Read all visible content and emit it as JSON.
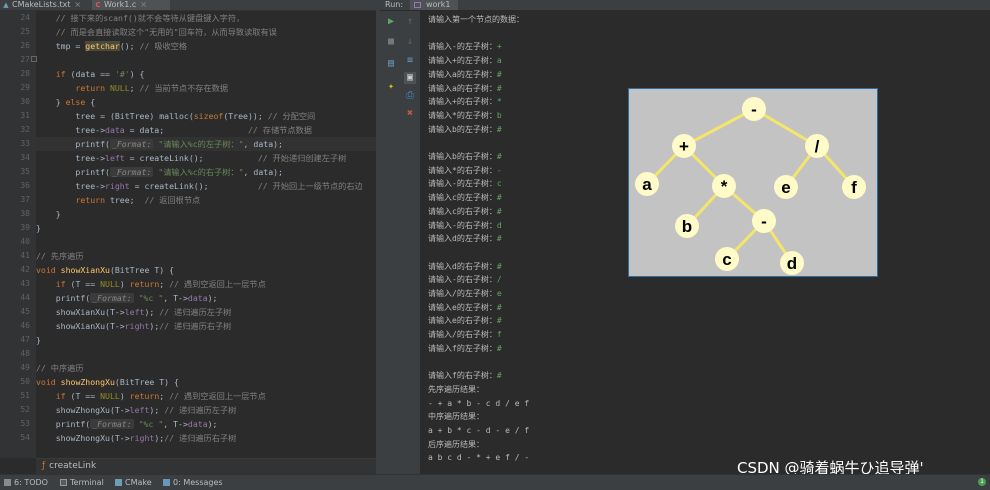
{
  "tabs": [
    {
      "label": "CMakeLists.txt",
      "icon": "cmake-file-icon"
    },
    {
      "label": "Work1.c",
      "icon": "c-file-icon"
    }
  ],
  "gutter": {
    "line_numbers": [
      "24",
      "25",
      "26",
      "27",
      "28",
      "29",
      "30",
      "31",
      "32",
      "33",
      "34",
      "35",
      "36",
      "37",
      "38",
      "39",
      "40",
      "41",
      "42",
      "43",
      "44",
      "45",
      "46",
      "47",
      "48",
      "49",
      "50",
      "51",
      "52",
      "53",
      "54"
    ]
  },
  "code": {
    "l1": "    // 接下来的scanf()就不会等待从键盘键入字符，",
    "l2": "    // 而是会直接读取这个\"无用的\"回车符，从而导致读取有误",
    "l3a": "    tmp = ",
    "l3b": "getchar",
    "l3c": "(); ",
    "l3d": "// 吸收空格",
    "l5a": "    if ",
    "l5b": "(data == ",
    "l5c": "'#'",
    "l5d": ") {",
    "l6a": "        return ",
    "l6b": "NULL",
    "l6c": "; ",
    "l6d": "// 当前节点不存在数据",
    "l7a": "    } ",
    "l7b": "else ",
    "l7c": "{",
    "l8a": "        tree = (BitTree) ",
    "l8b": "malloc",
    "l8c": "(",
    "l8d": "sizeof",
    "l8e": "(Tree)); ",
    "l8f": "// 分配空间",
    "l9a": "        tree->",
    "l9b": "data",
    "l9c": " = data;                 ",
    "l9d": "// 存储节点数据",
    "l10a": "        printf(",
    "l10h": "_Format:",
    "l10b": " \"请输入%c的左子树：\"",
    "l10c": ", data);",
    "l11a": "        tree->",
    "l11b": "left",
    "l11c": " = createLink();           ",
    "l11d": "// 开始递归创建左子树",
    "l12a": "        printf(",
    "l12h": "_Format:",
    "l12b": " \"请输入%c的右子树：\"",
    "l12c": ", data);",
    "l13a": "        tree->",
    "l13b": "right",
    "l13c": " = createLink();          ",
    "l13d": "// 开始回上一级节点的右边",
    "l14a": "        ",
    "l14b": "return ",
    "l14c": "tree;  ",
    "l14d": "// 返回根节点",
    "l15": "    }",
    "l16": "}",
    "l18": "// 先序遍历",
    "l19a": "void ",
    "l19b": "showXianXu",
    "l19c": "(BitTree T) {",
    "l20a": "    if ",
    "l20b": "(T == ",
    "l20c": "NULL",
    "l20d": ") ",
    "l20e": "return",
    "l20f": "; ",
    "l20g": "// 遇到空返回上一层节点",
    "l21a": "    printf(",
    "l21h": "_Format:",
    "l21b": " \"%c \"",
    "l21c": ", T->",
    "l21d": "data",
    "l21e": ");",
    "l22a": "    showXianXu(T->",
    "l22b": "left",
    "l22c": "); ",
    "l22d": "// 递归遍历左子树",
    "l23a": "    showXianXu(T->",
    "l23b": "right",
    "l23c": ");",
    "l23d": "// 递归遍历右子树",
    "l24": "}",
    "l26": "// 中序遍历",
    "l27a": "void ",
    "l27b": "showZhongXu",
    "l27c": "(BitTree T) {",
    "l28a": "    if ",
    "l28b": "(T == ",
    "l28c": "NULL",
    "l28d": ") ",
    "l28e": "return",
    "l28f": "; ",
    "l28g": "// 遇到空返回上一层节点",
    "l29a": "    showZhongXu(T->",
    "l29b": "left",
    "l29c": "); ",
    "l29d": "// 递归遍历左子树",
    "l30a": "    printf(",
    "l30h": "_Format:",
    "l30b": " \"%c \"",
    "l30c": ", T->",
    "l30d": "data",
    "l30e": ");",
    "l31a": "    showZhongXu(T->",
    "l31b": "right",
    "l31c": ");",
    "l31d": "// 递归遍历右子树"
  },
  "breadcrumb": {
    "icon": "function-icon",
    "label": "createLink"
  },
  "statusbar": {
    "todo": "6: TODO",
    "terminal": "Terminal",
    "cmake": "CMake",
    "messages": "0: Messages",
    "notifications": "1"
  },
  "run": {
    "label": "Run:",
    "tab": "work1"
  },
  "console": {
    "lines": [
      {
        "t": "请输入第一个节点的数据：",
        "i": ""
      },
      {
        "t": "",
        "i": ""
      },
      {
        "t": "请输入-的左子树：",
        "i": "+"
      },
      {
        "t": "请输入+的左子树：",
        "i": "a"
      },
      {
        "t": "请输入a的左子树：",
        "i": "#"
      },
      {
        "t": "请输入a的右子树：",
        "i": "#"
      },
      {
        "t": "请输入+的右子树：",
        "i": "*"
      },
      {
        "t": "请输入*的左子树：",
        "i": "b"
      },
      {
        "t": "请输入b的左子树：",
        "i": "#"
      },
      {
        "t": "",
        "i": ""
      },
      {
        "t": "请输入b的右子树：",
        "i": "#"
      },
      {
        "t": "请输入*的右子树：",
        "i": "-"
      },
      {
        "t": "请输入-的左子树：",
        "i": "c"
      },
      {
        "t": "请输入c的左子树：",
        "i": "#"
      },
      {
        "t": "请输入c的右子树：",
        "i": "#"
      },
      {
        "t": "请输入-的右子树：",
        "i": "d"
      },
      {
        "t": "请输入d的左子树：",
        "i": "#"
      },
      {
        "t": "",
        "i": ""
      },
      {
        "t": "请输入d的右子树：",
        "i": "#"
      },
      {
        "t": "请输入-的右子树：",
        "i": "/"
      },
      {
        "t": "请输入/的左子树：",
        "i": "e"
      },
      {
        "t": "请输入e的左子树：",
        "i": "#"
      },
      {
        "t": "请输入e的右子树：",
        "i": "#"
      },
      {
        "t": "请输入/的右子树：",
        "i": "f"
      },
      {
        "t": "请输入f的左子树：",
        "i": "#"
      },
      {
        "t": "",
        "i": ""
      },
      {
        "t": "请输入f的右子树：",
        "i": "#"
      },
      {
        "t": "先序遍历结果：",
        "i": ""
      },
      {
        "t": "- + a * b - c d / e f",
        "i": ""
      },
      {
        "t": "中序遍历结果：",
        "i": ""
      },
      {
        "t": "a + b * c - d - e / f",
        "i": ""
      },
      {
        "t": "后序遍历结果：",
        "i": ""
      },
      {
        "t": "a b c d - * + e f / -",
        "i": ""
      }
    ]
  },
  "tree": {
    "nodes": [
      "-",
      "+",
      "/",
      "a",
      "*",
      "e",
      "f",
      "b",
      "-",
      "c",
      "d"
    ],
    "colors": {
      "background": "#c3c3c3",
      "node_fill": "#fffbc8",
      "edge": "#f5e66a",
      "text": "#000000"
    }
  },
  "watermark": "CSDN @骑着蜗牛ひ追导弹'"
}
